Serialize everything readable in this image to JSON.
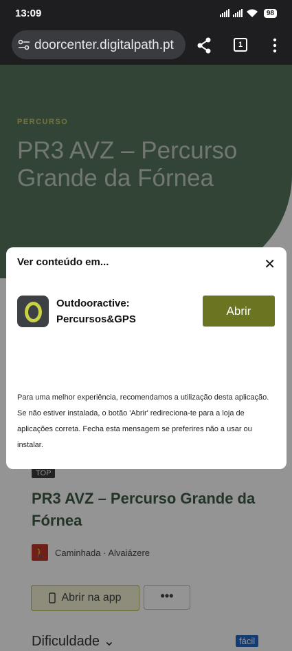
{
  "status_bar": {
    "time": "13:09",
    "battery": "98"
  },
  "browser": {
    "url": "doorcenter.digitalpath.pt",
    "tab_count": "1"
  },
  "page": {
    "eyebrow": "PERCURSO",
    "hero_title": "PR3 AVZ – Percurso Grande da Fórnea",
    "tag": "TOP",
    "title": "PR3 AVZ – Percurso Grande da Fórnea",
    "meta": "Caminhada · Alvaiázere",
    "open_app_label": "Abrir na app",
    "more_label": "•••",
    "difficulty_label": "Dificuldade",
    "difficulty_value": "fácil"
  },
  "modal": {
    "title": "Ver conteúdo em...",
    "close_label": "✕",
    "app_name": "Outdooractive: Percursos&GPS",
    "open_label": "Abrir",
    "description": "Para uma melhor experiência, recomendamos a utilização desta aplicação. Se não estiver instalada, o botão 'Abrir' redireciona-te para a loja de aplicações correta. Fecha esta mensagem se preferires não a usar ou instalar."
  },
  "icons": {
    "share": "share-icon",
    "menu": "more-vert-icon",
    "site_settings": "tune-icon",
    "hiking": "hiking-icon"
  },
  "colors": {
    "hero": "#56765d",
    "open_button": "#6b7521",
    "app_icon_bg": "#3d4045",
    "app_icon_ring": "#c7d244"
  }
}
